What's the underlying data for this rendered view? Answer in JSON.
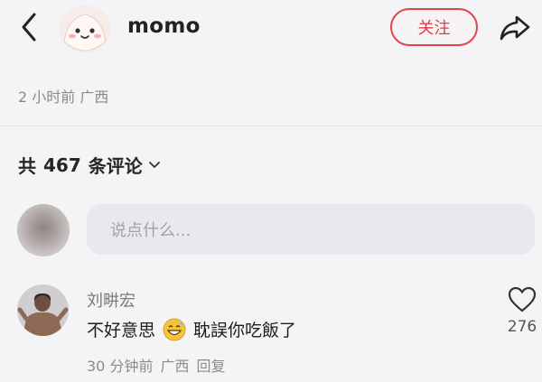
{
  "header": {
    "username": "momo",
    "follow_label": "关注"
  },
  "post_meta": {
    "time": "2 小时前",
    "location": "广西"
  },
  "comments_section": {
    "count_prefix": "共",
    "count": "467",
    "count_suffix": "条评论",
    "input_placeholder": "说点什么..."
  },
  "comment": {
    "author": "刘畊宏",
    "text_before": "不好意思",
    "text_after": "耽誤你吃飯了",
    "time": "30 分钟前",
    "location": "广西",
    "reply_label": "回复",
    "likes": "276"
  },
  "colors": {
    "accent": "#e03b46",
    "background": "#f4f4f6",
    "input_bg": "#e9e9ed"
  },
  "icons": {
    "back": "chevron-left-icon",
    "share": "share-arrow-icon",
    "chevron": "chevron-down-icon",
    "like": "heart-outline-icon",
    "emoji": "grinning-sweat-emoji"
  }
}
